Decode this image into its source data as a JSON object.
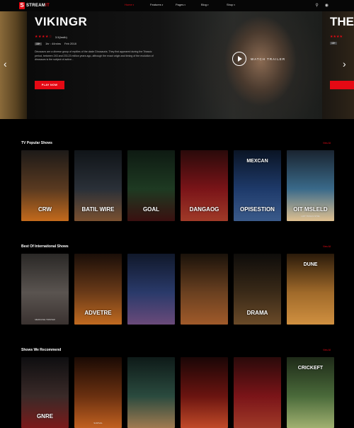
{
  "header": {
    "logo_mark": "S",
    "logo_prefix": "STREAM",
    "logo_suffix": "IT",
    "nav": [
      {
        "label": "Home",
        "caret": "▾"
      },
      {
        "label": "Features",
        "caret": "▾"
      },
      {
        "label": "Pages",
        "caret": "▾"
      },
      {
        "label": "Blog",
        "caret": "▾"
      },
      {
        "label": "Shop",
        "caret": "▾"
      }
    ],
    "icons": [
      "search-icon",
      "user-icon"
    ]
  },
  "hero": {
    "title": "VIKINGR",
    "stars": "★★★★☆",
    "rating_text": "3.5(lmdb)",
    "badge": "15+",
    "duration": "1hr : 44mins",
    "date": "Feb 2018",
    "description": "Dinosaurs are a diverse group of reptiles of the clade Dinosauria. They first appeared during the Triassic period, between 243 and 233.23 million years ago, although the exact origin and timing of the evolution of dinosaurs is the subject of active...",
    "play_label": "PLAY NOW",
    "trailer_label": "WATCH TRAILER",
    "next_title_peek": "THE",
    "next_stars": "★★★★",
    "next_badge": "15+",
    "prev_arrow": "‹",
    "next_arrow": "›"
  },
  "sections": [
    {
      "title": "TV Popular Shows",
      "view_all": "View All",
      "cards": [
        {
          "text": "CRW",
          "sub": "",
          "colors": [
            "#1d1a18",
            "#5a3a20",
            "#c46a1c"
          ]
        },
        {
          "text": "BATIL WIRE",
          "sub": "",
          "colors": [
            "#101418",
            "#2a3038",
            "#7a5030"
          ]
        },
        {
          "text": "GOAL",
          "sub": "",
          "colors": [
            "#0e1a12",
            "#1e3a22",
            "#3a1010"
          ]
        },
        {
          "text": "DANGAOG",
          "sub": "",
          "colors": [
            "#2a0a0a",
            "#7a1418",
            "#a03a28"
          ]
        },
        {
          "text": "OPISESTION",
          "top": "MEXCAN",
          "colors": [
            "#0a1424",
            "#1e3a6a",
            "#3a5a8a"
          ]
        },
        {
          "text": "OIT MSLELD",
          "sub": "HOT TRAILS STIIE",
          "colors": [
            "#1a2430",
            "#3a6a8a",
            "#e0c090"
          ]
        }
      ]
    },
    {
      "title": "Best Of International Shows",
      "view_all": "View All",
      "cards": [
        {
          "text": "",
          "sub": "MERCUSE TRISTER",
          "colors": [
            "#2a2826",
            "#5a5450",
            "#3a3230"
          ]
        },
        {
          "text": "ADVETRE",
          "sub": "",
          "colors": [
            "#1a0e08",
            "#6a3a18",
            "#c06a20"
          ]
        },
        {
          "text": "",
          "sub": "",
          "colors": [
            "#10182a",
            "#2a3a6a",
            "#6a4a7a"
          ]
        },
        {
          "text": "",
          "sub": "",
          "colors": [
            "#1a120a",
            "#6a4020",
            "#a05a2a"
          ]
        },
        {
          "text": "DRAMA",
          "sub": "",
          "colors": [
            "#0e0c0a",
            "#3a2a18",
            "#6a4a28"
          ]
        },
        {
          "text": "",
          "top": "DUNE",
          "colors": [
            "#2a1a0a",
            "#a06a2a",
            "#d09040"
          ]
        }
      ]
    },
    {
      "title": "Shows We Recommend",
      "view_all": "View All",
      "cards": [
        {
          "text": "GNRE",
          "sub": "",
          "colors": [
            "#0e0e10",
            "#3a2a28",
            "#7a1a1a"
          ]
        },
        {
          "text": "",
          "sub": "SURIVAL",
          "colors": [
            "#1a0a04",
            "#6a3010",
            "#c06020"
          ]
        },
        {
          "text": "",
          "sub": "",
          "colors": [
            "#0e1a18",
            "#2a4a3e",
            "#a07a50"
          ]
        },
        {
          "text": "",
          "sub": "",
          "colors": [
            "#1a0606",
            "#6a1410",
            "#c04a28"
          ]
        },
        {
          "text": "",
          "sub": "",
          "colors": [
            "#2a0a0a",
            "#7a1418",
            "#a03a28"
          ]
        },
        {
          "text": "",
          "top": "CRICKEFT",
          "colors": [
            "#1e2a18",
            "#4a6a3a",
            "#a0b070"
          ]
        }
      ]
    }
  ]
}
